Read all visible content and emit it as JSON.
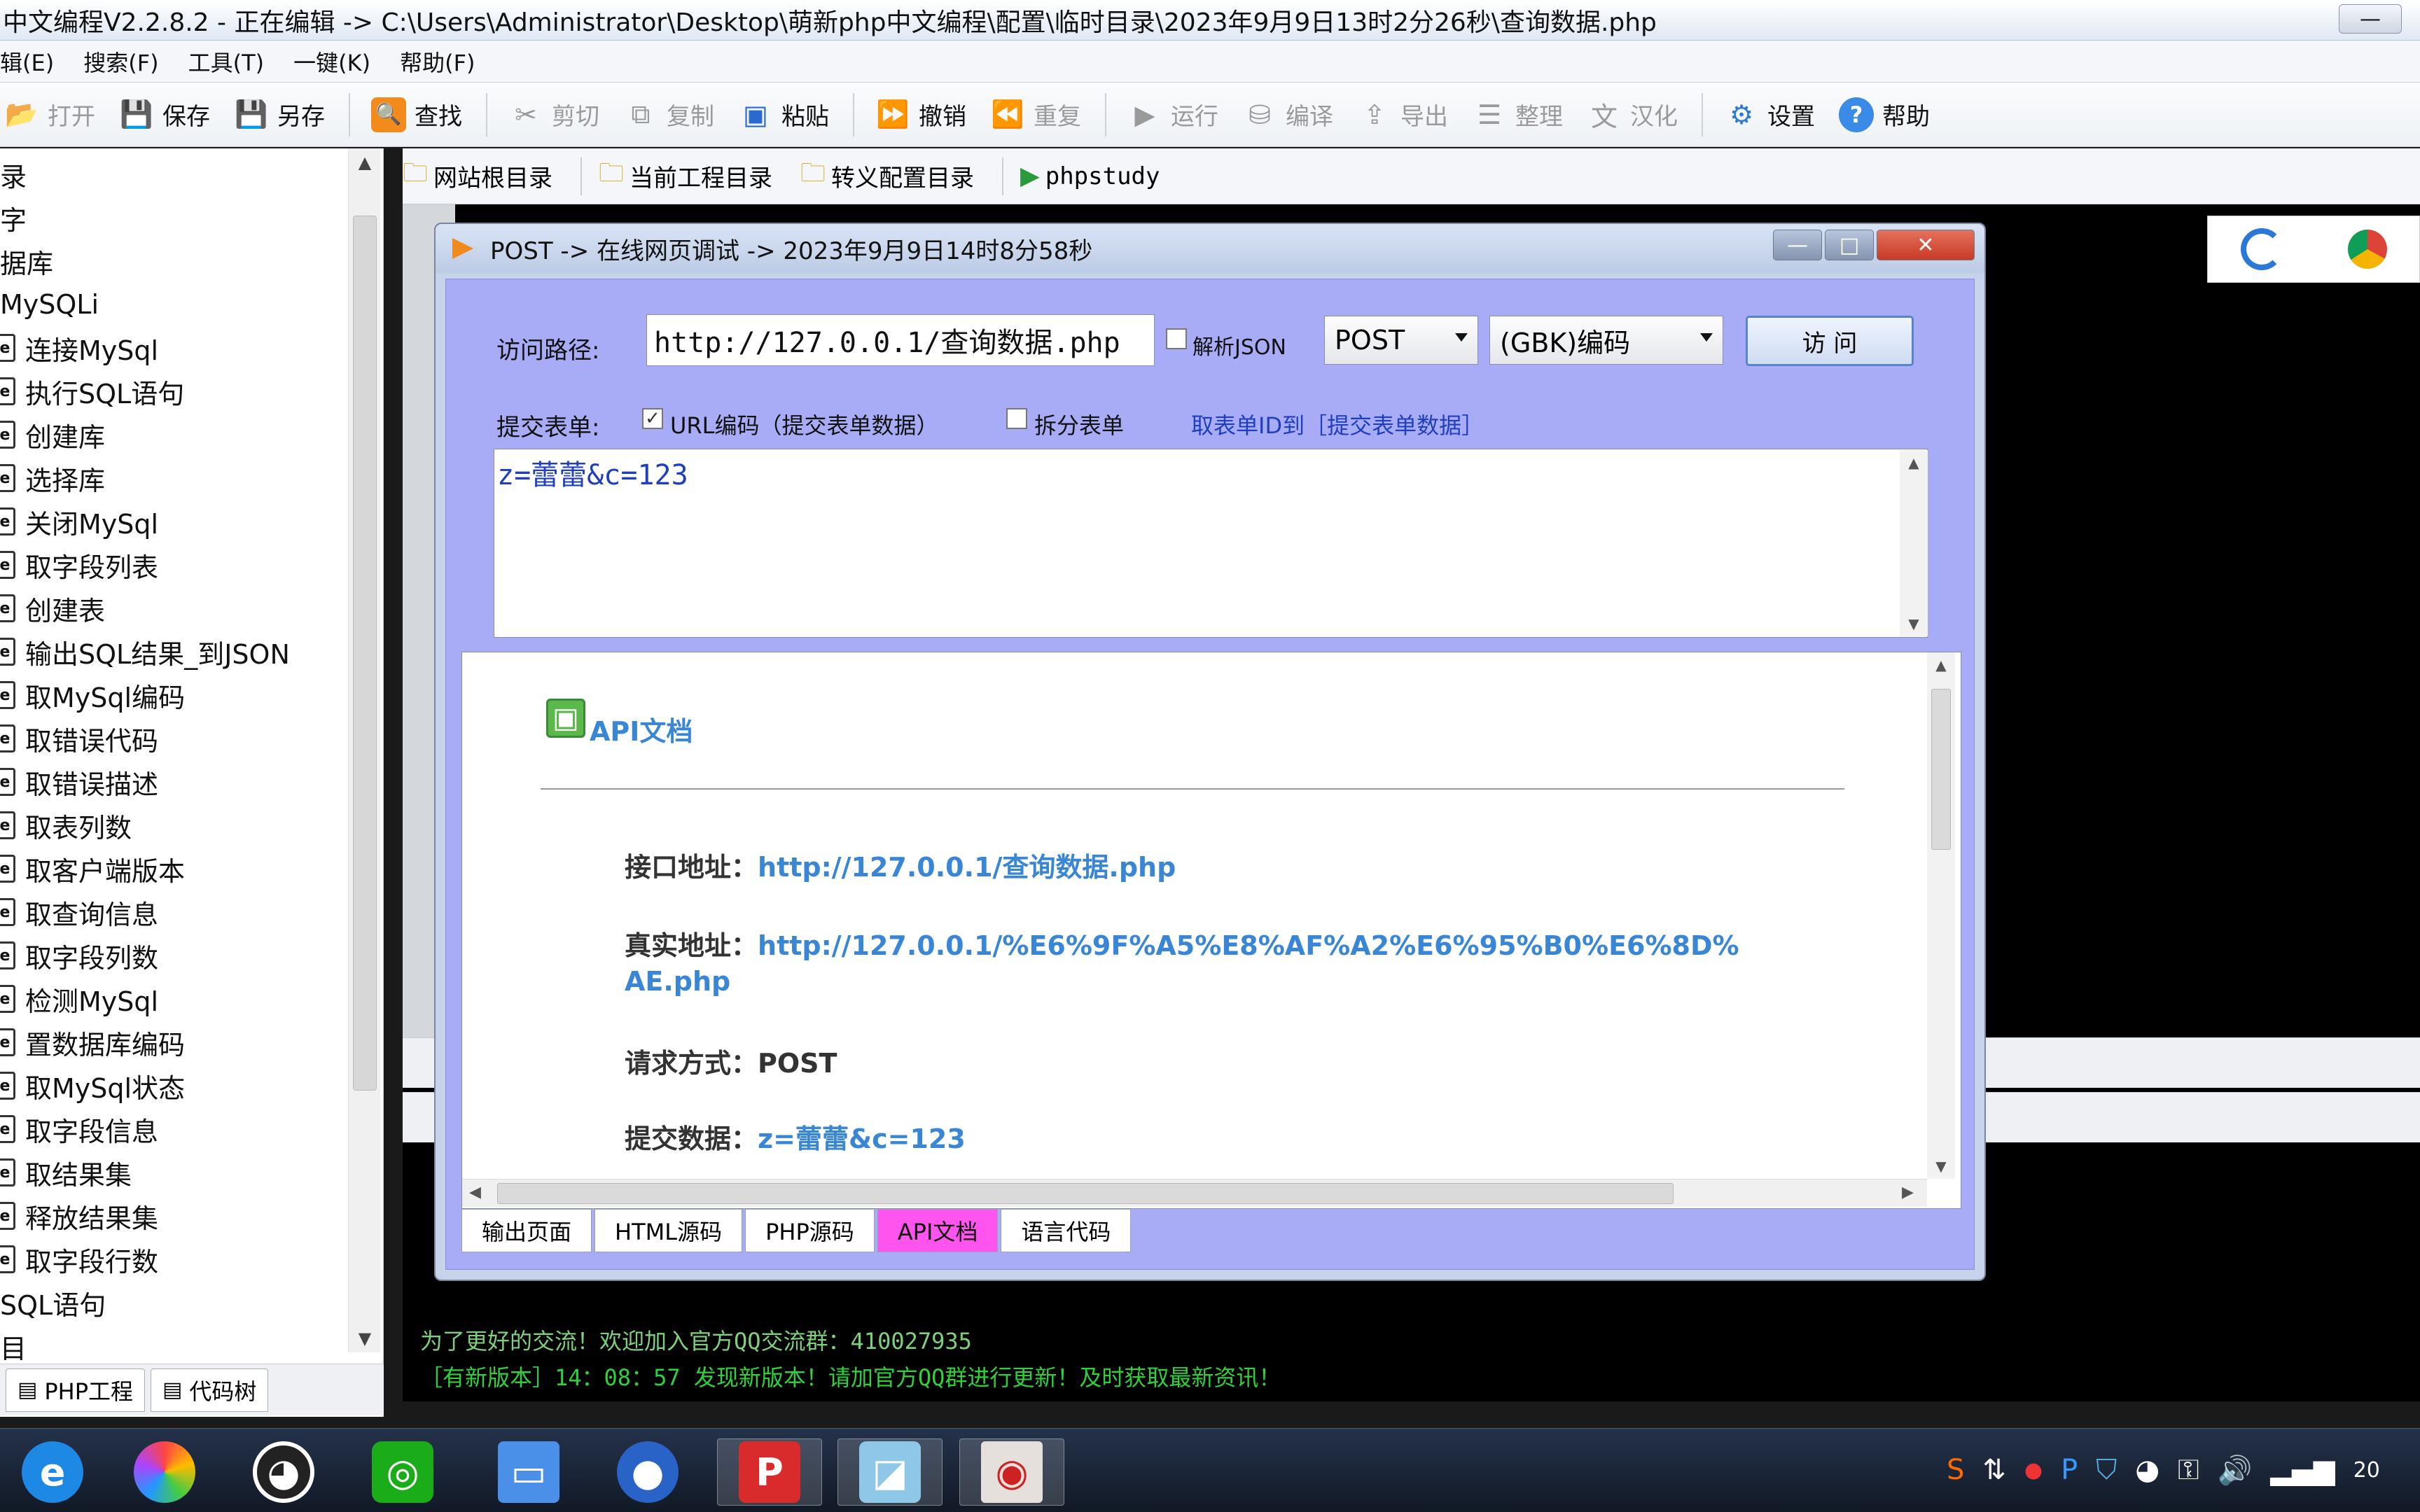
{
  "window": {
    "title": "中文编程V2.2.8.2 - 正在编辑 -> C:\\Users\\Administrator\\Desktop\\萌新php中文编程\\配置\\临时目录\\2023年9月9日13时2分26秒\\查询数据.php",
    "min": "—",
    "max": "□"
  },
  "menu": [
    "辑(E)",
    "搜索(F)",
    "工具(T)",
    "一键(K)",
    "帮助(F)"
  ],
  "toolbar": [
    {
      "label": "打开",
      "icon": "open-icon",
      "disabled": true
    },
    {
      "label": "保存",
      "icon": "save-icon",
      "disabled": false
    },
    {
      "label": "另存",
      "icon": "saveas-icon",
      "disabled": false
    },
    {
      "label": "查找",
      "icon": "find-icon",
      "disabled": false
    },
    {
      "label": "剪切",
      "icon": "cut-icon",
      "disabled": true
    },
    {
      "label": "复制",
      "icon": "copy-icon",
      "disabled": true
    },
    {
      "label": "粘贴",
      "icon": "paste-icon",
      "disabled": false
    },
    {
      "label": "撤销",
      "icon": "undo-icon",
      "disabled": false
    },
    {
      "label": "重复",
      "icon": "redo-icon",
      "disabled": true
    },
    {
      "label": "运行",
      "icon": "run-icon",
      "disabled": true
    },
    {
      "label": "编译",
      "icon": "compile-icon",
      "disabled": true
    },
    {
      "label": "导出",
      "icon": "export-icon",
      "disabled": true
    },
    {
      "label": "整理",
      "icon": "format-icon",
      "disabled": true
    },
    {
      "label": "汉化",
      "icon": "translate-icon",
      "disabled": true
    },
    {
      "label": "设置",
      "icon": "gear-icon",
      "disabled": false
    },
    {
      "label": "帮助",
      "icon": "help-icon",
      "disabled": false
    }
  ],
  "tree": {
    "top_items": [
      "录",
      "字",
      "据库",
      "MySQLi"
    ],
    "items": [
      "连接MySql",
      "执行SQL语句",
      "创建库",
      "选择库",
      "关闭MySql",
      "取字段列表",
      "创建表",
      "输出SQL结果_到JSON",
      "取MySql编码",
      "取错误代码",
      "取错误描述",
      "取表列数",
      "取客户端版本",
      "取查询信息",
      "取字段列数",
      "检测MySql",
      "置数据库编码",
      "取MySql状态",
      "取字段信息",
      "取结果集",
      "释放结果集",
      "取字段行数"
    ],
    "bottom_items": [
      "SQL语句",
      "目"
    ],
    "file_icon_glyph": "e"
  },
  "left_tabs": [
    "PHP工程",
    "代码树"
  ],
  "pathbar": [
    "网站根目录",
    "当前工程目录",
    "转义配置目录",
    "phpstudy"
  ],
  "dialog": {
    "title": "POST -> 在线网页调试 ->  2023年9月9日14时8分58秒",
    "close": "✕",
    "url_label": "访问路径:",
    "url_value": "http://127.0.0.1/查询数据.php",
    "parse_json": "解析JSON",
    "method": "POST",
    "encoding": "(GBK)编码",
    "visit": "访 问",
    "form_label": "提交表单:",
    "urlencode": "URL编码（提交表单数据）",
    "split_form": "拆分表单",
    "get_form_id": "取表单ID到［提交表单数据］",
    "post_data": "z=蕾蕾&c=123",
    "api": {
      "heading": "API文档",
      "rows": [
        {
          "label": "接口地址：",
          "value": "http://127.0.0.1/查询数据.php"
        },
        {
          "label": "真实地址：",
          "value": "http://127.0.0.1/%E6%9F%A5%E8%AF%A2%E6%95%B0%E6%8D%",
          "value2": "AE.php"
        },
        {
          "label": "请求方式：",
          "value": "POST"
        },
        {
          "label": "提交数据：",
          "value": "z=蕾蕾&c=123"
        }
      ]
    },
    "tabs": [
      "输出页面",
      "HTML源码",
      "PHP源码",
      "API文档",
      "语言代码"
    ],
    "active_tab": 3
  },
  "console": [
    "为了更好的交流！欢迎加入官方QQ交流群：410027935",
    "［有新版本］14：08：57 发现新版本！请加官方QQ群进行更新！及时获取最新资讯！"
  ],
  "tray_time": "20"
}
